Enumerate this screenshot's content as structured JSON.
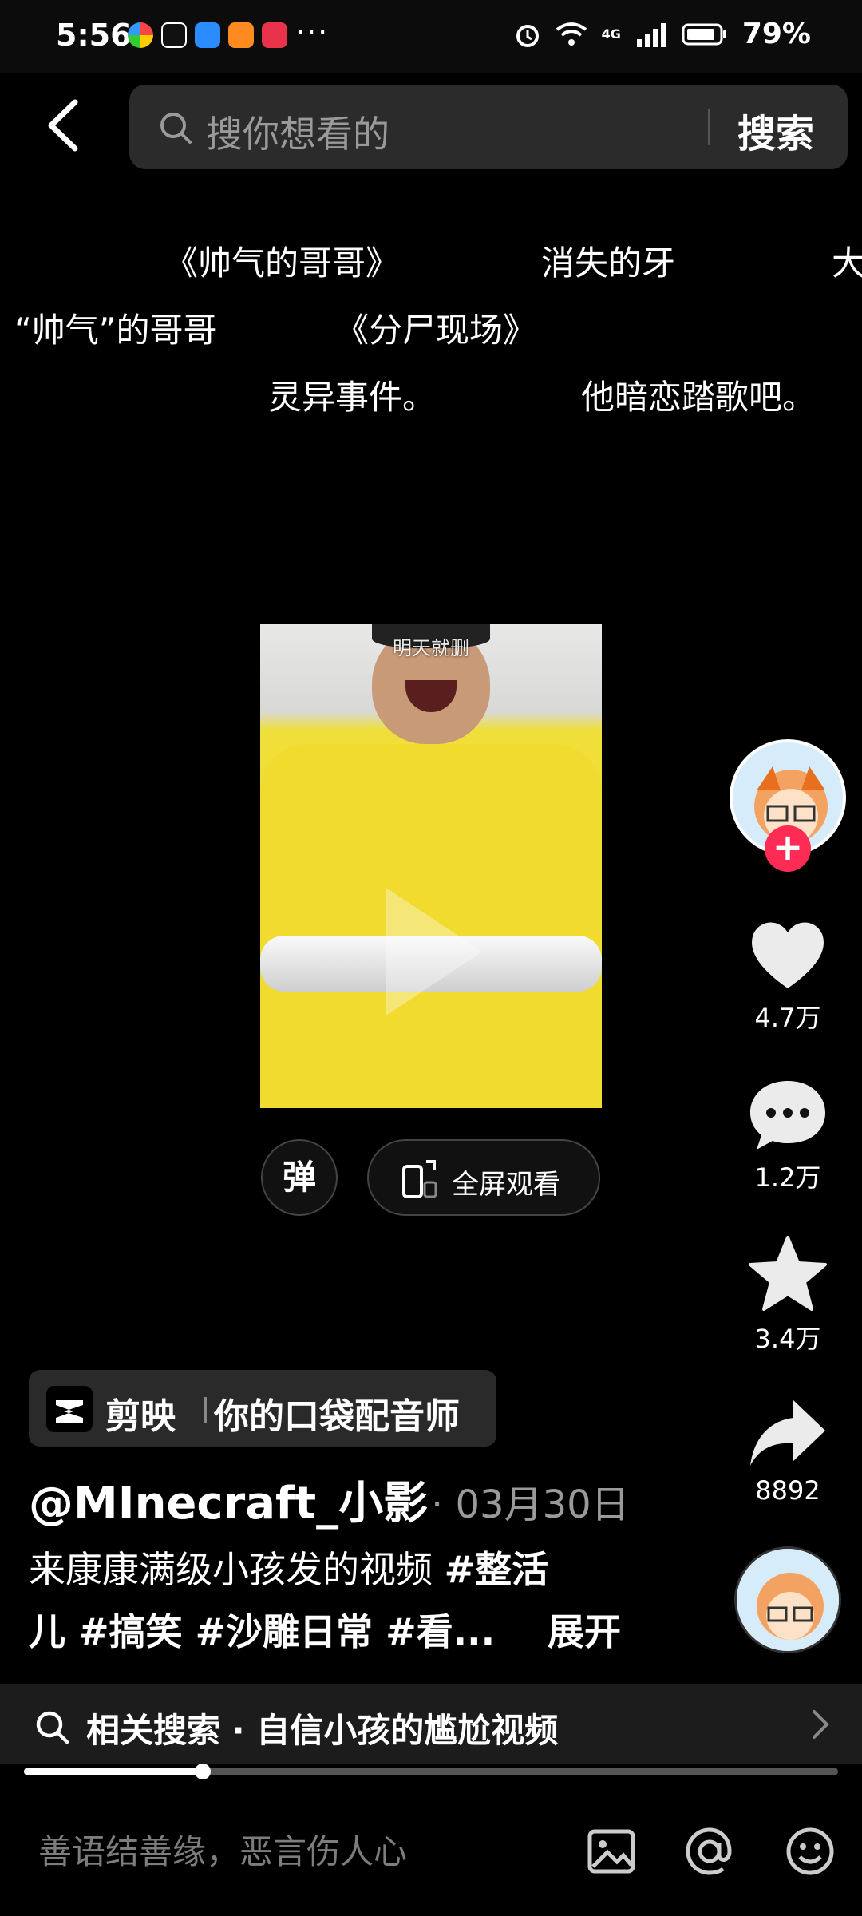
{
  "status_bar": {
    "time": "5:56",
    "more": "···",
    "battery_percent": "79%",
    "network": "4G"
  },
  "header": {
    "search_placeholder": "搜你想看的",
    "search_button": "搜索"
  },
  "danmaku": [
    "《帅气的哥哥》",
    "消失的牙",
    "大",
    "“帅气”的哥哥",
    "《分尸现场》",
    "灵异事件。",
    "他暗恋踏歌吧。"
  ],
  "video": {
    "caption": "明天就删"
  },
  "video_controls": {
    "danmu_label": "弹",
    "fullscreen_label": "全屏观看"
  },
  "rail": {
    "likes": "4.7万",
    "comments": "1.2万",
    "favorites": "3.4万",
    "shares": "8892"
  },
  "promo": {
    "app_name": "剪映",
    "tagline": "你的口袋配音师"
  },
  "post": {
    "author": "@MInecraft_小影",
    "date": "· 03月30日",
    "desc_line1_text": "来康康满级小孩发的视频 ",
    "desc_line1_tag": "#整活",
    "desc_line2_text": "儿 #搞笑 #沙雕日常 #看...",
    "expand": "展开"
  },
  "related_search": {
    "text": "相关搜索 · 自信小孩的尴尬视频"
  },
  "progress": {
    "fraction": 0.22
  },
  "comment_bar": {
    "placeholder": "善语结善缘，恶言伤人心"
  },
  "colors": {
    "accent_red": "#fe2c55",
    "background": "#000000",
    "search_bg": "#2b2b2b"
  }
}
